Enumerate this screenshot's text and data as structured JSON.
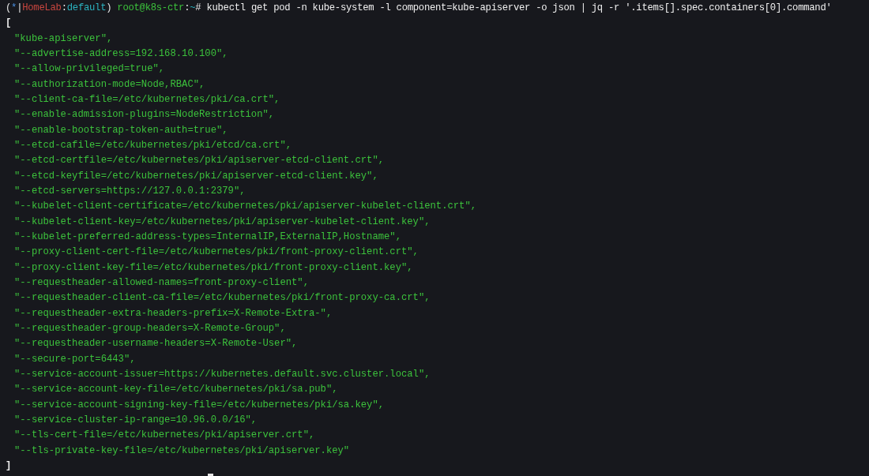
{
  "prompt": [
    {
      "text": "(",
      "kind": "punct"
    },
    {
      "text": "*",
      "kind": "symbol"
    },
    {
      "text": "|",
      "kind": "punct"
    },
    {
      "text": "HomeLab",
      "kind": "cluster"
    },
    {
      "text": ":",
      "kind": "punct"
    },
    {
      "text": "default",
      "kind": "namespace"
    },
    {
      "text": ") ",
      "kind": "punct"
    },
    {
      "text": "root@k8s-ctr",
      "kind": "host"
    },
    {
      "text": ":",
      "kind": "punct"
    },
    {
      "text": "~",
      "kind": "path"
    },
    {
      "text": "# kubectl get pod -n kube-system -l component=kube-apiserver -o json | jq -r '.items[].spec.containers[0].command'",
      "kind": "command"
    }
  ],
  "output": [
    {
      "kind": "bracket",
      "text": "["
    },
    {
      "kind": "string",
      "text": "\"kube-apiserver\","
    },
    {
      "kind": "string",
      "text": "\"--advertise-address=192.168.10.100\","
    },
    {
      "kind": "string",
      "text": "\"--allow-privileged=true\","
    },
    {
      "kind": "string",
      "text": "\"--authorization-mode=Node,RBAC\","
    },
    {
      "kind": "string",
      "text": "\"--client-ca-file=/etc/kubernetes/pki/ca.crt\","
    },
    {
      "kind": "string",
      "text": "\"--enable-admission-plugins=NodeRestriction\","
    },
    {
      "kind": "string",
      "text": "\"--enable-bootstrap-token-auth=true\","
    },
    {
      "kind": "string",
      "text": "\"--etcd-cafile=/etc/kubernetes/pki/etcd/ca.crt\","
    },
    {
      "kind": "string",
      "text": "\"--etcd-certfile=/etc/kubernetes/pki/apiserver-etcd-client.crt\","
    },
    {
      "kind": "string",
      "text": "\"--etcd-keyfile=/etc/kubernetes/pki/apiserver-etcd-client.key\","
    },
    {
      "kind": "string",
      "text": "\"--etcd-servers=https://127.0.0.1:2379\","
    },
    {
      "kind": "string",
      "text": "\"--kubelet-client-certificate=/etc/kubernetes/pki/apiserver-kubelet-client.crt\","
    },
    {
      "kind": "string",
      "text": "\"--kubelet-client-key=/etc/kubernetes/pki/apiserver-kubelet-client.key\","
    },
    {
      "kind": "string",
      "text": "\"--kubelet-preferred-address-types=InternalIP,ExternalIP,Hostname\","
    },
    {
      "kind": "string",
      "text": "\"--proxy-client-cert-file=/etc/kubernetes/pki/front-proxy-client.crt\","
    },
    {
      "kind": "string",
      "text": "\"--proxy-client-key-file=/etc/kubernetes/pki/front-proxy-client.key\","
    },
    {
      "kind": "string",
      "text": "\"--requestheader-allowed-names=front-proxy-client\","
    },
    {
      "kind": "string",
      "text": "\"--requestheader-client-ca-file=/etc/kubernetes/pki/front-proxy-ca.crt\","
    },
    {
      "kind": "string",
      "text": "\"--requestheader-extra-headers-prefix=X-Remote-Extra-\","
    },
    {
      "kind": "string",
      "text": "\"--requestheader-group-headers=X-Remote-Group\","
    },
    {
      "kind": "string",
      "text": "\"--requestheader-username-headers=X-Remote-User\","
    },
    {
      "kind": "string",
      "text": "\"--secure-port=6443\","
    },
    {
      "kind": "string",
      "text": "\"--service-account-issuer=https://kubernetes.default.svc.cluster.local\","
    },
    {
      "kind": "string",
      "text": "\"--service-account-key-file=/etc/kubernetes/pki/sa.pub\","
    },
    {
      "kind": "string",
      "text": "\"--service-account-signing-key-file=/etc/kubernetes/pki/sa.key\","
    },
    {
      "kind": "string",
      "text": "\"--service-cluster-ip-range=10.96.0.0/16\","
    },
    {
      "kind": "string",
      "text": "\"--tls-cert-file=/etc/kubernetes/pki/apiserver.crt\","
    },
    {
      "kind": "string",
      "text": "\"--tls-private-key-file=/etc/kubernetes/pki/apiserver.key\""
    },
    {
      "kind": "bracket",
      "text": "]"
    }
  ]
}
